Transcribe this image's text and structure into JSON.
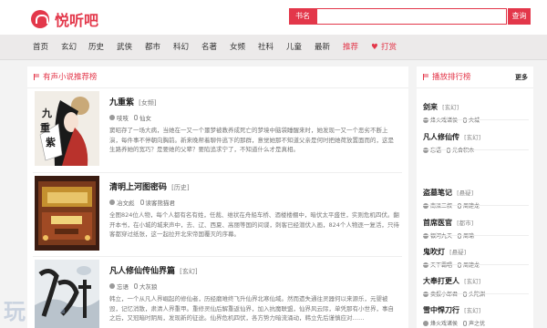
{
  "site": {
    "name": "悦听吧"
  },
  "search": {
    "select_label": "书名",
    "placeholder": "",
    "button_label": "查询"
  },
  "nav": [
    "首页",
    "玄幻",
    "历史",
    "武侠",
    "都市",
    "科幻",
    "名著",
    "女频",
    "社科",
    "儿童",
    "最新",
    "推荐",
    "打赏"
  ],
  "main": {
    "section_title": "有声小说推荐榜",
    "books": [
      {
        "title": "九重紫",
        "tag": "[女频]",
        "author": "吱吱",
        "narrator": "仙女",
        "desc": "窦昭存了一场大病，当她在一又一个噩梦被教养成死亡的梦境中脑袋睡醒来时，她发现一又一个恶劣不断上演，每件事不停朝向胸前。新来晚帮着聊件逃下的那群，意觉她那不知道父亲是何时把她荷放置面而的，这是生路养她的宽巧？是要她的父辈？要陷追求宁了，不知道什么才是真相。"
      },
      {
        "title": "清明上河图密码",
        "tag": "[历史]",
        "author": "冶文彪",
        "narrator": "读客熊猫君",
        "desc": "全图824位人物，每个人都有名有姓，任裁、维状在舟船车桥、酒楼楼棚中，暗伏太平盛世，实则危机四伏。翻开本书，在小城的城来声中，去、辽、西夏、高丽等国的间谍，刺客已经潜伏入画，824个人物逐一复活，只待客都穿过纸张，这一起拉开北宋帝国覆灭的序幕。"
      },
      {
        "title": "凡人修仙传仙界篇",
        "tag": "[玄幻]",
        "author": "忘语",
        "narrator": "大灰狼",
        "desc": "韩立，一个从凡人界崛起的修仙者，历经磨难终飞升仙界北寒仙域。然而遗失通往灵器何以来源乐，元婴被毁，记忆消散，肃清人界重甲。重修灵仙后解重返仙界，加入抗魔联盟，仙界风云际，单凭那有小世界，事自之后，又冠暗时阴局，发现新的征途。仙界危机四伏，各方势力暗流涌动，韩立先后谨慎应对……"
      }
    ]
  },
  "side": {
    "section_title": "播放排行榜",
    "more_label": "更多",
    "items": [
      {
        "title": "剑来",
        "tag": "[玄幻]",
        "author": "烽火戏诸侯",
        "narrator": "大城"
      },
      {
        "title": "凡人修仙传",
        "tag": "[玄幻]",
        "author": "忘语",
        "narrator": "光合积木"
      },
      {
        "title": "盗墓笔记",
        "tag": "[悬疑]",
        "author": "南派三叔",
        "narrator": "周建龙"
      },
      {
        "title": "首席医官",
        "tag": "[都市]",
        "author": "银河九天",
        "narrator": "周瑜"
      },
      {
        "title": "鬼吹灯",
        "tag": "[悬疑]",
        "author": "天下霸唱",
        "narrator": "周建龙"
      },
      {
        "title": "大奉打更人",
        "tag": "[玄幻]",
        "author": "卖报小郎君",
        "narrator": "头陀渊"
      },
      {
        "title": "雪中悍刀行",
        "tag": "[玄幻]",
        "author": "烽火戏诸侯",
        "narrator": "声之优"
      }
    ]
  }
}
